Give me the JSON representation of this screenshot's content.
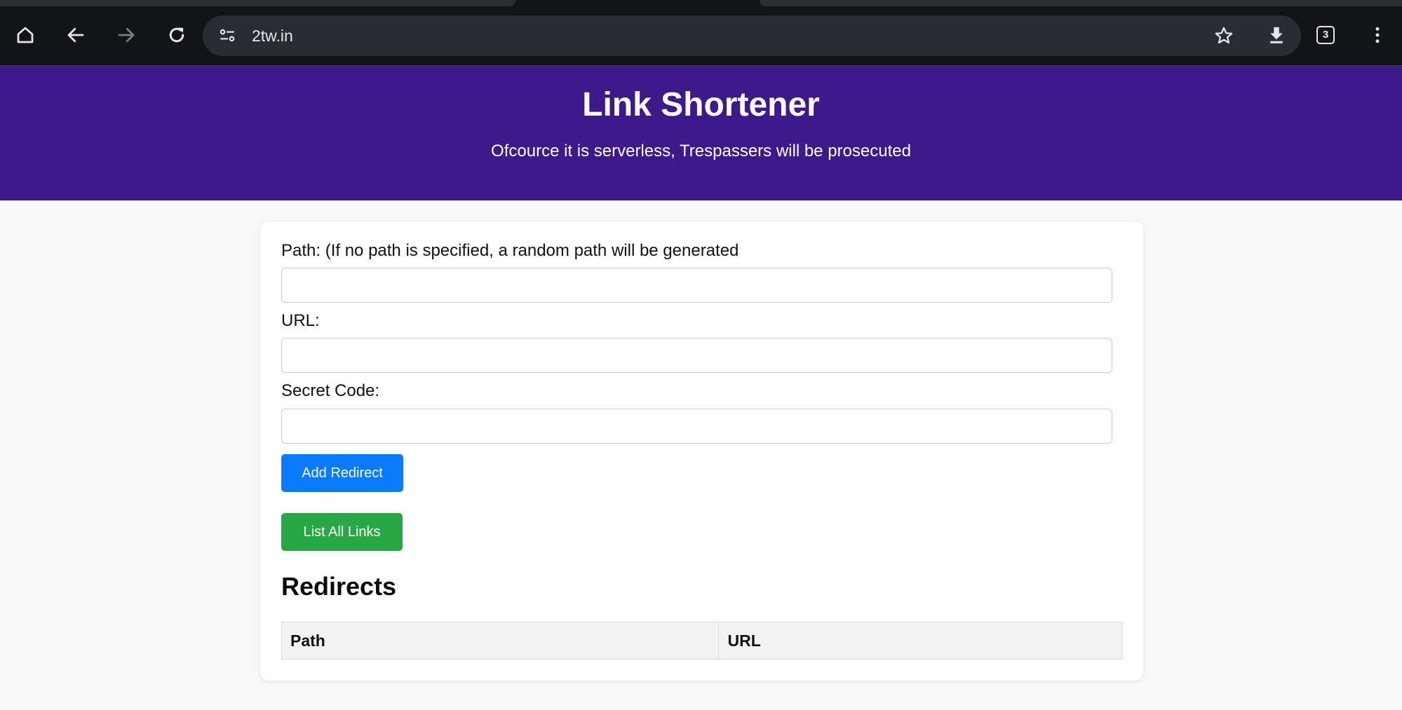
{
  "browser": {
    "url": "2tw.in",
    "tab_count": "3",
    "icons": {
      "home": "home-icon",
      "back": "back-arrow-icon",
      "forward": "forward-arrow-icon",
      "reload": "reload-icon",
      "site_info": "site-settings-icon",
      "bookmark": "star-icon",
      "download": "download-icon",
      "menu": "kebab-menu-icon"
    }
  },
  "header": {
    "title": "Link Shortener",
    "subtitle": "Ofcource it is serverless, Trespassers will be prosecuted",
    "background_color": "#3d198a"
  },
  "form": {
    "path_label": "Path: (If no path is specified, a random path will be generated",
    "path_value": "",
    "url_label": "URL:",
    "url_value": "",
    "secret_label": "Secret Code:",
    "secret_value": "",
    "add_button": "Add Redirect",
    "list_button": "List All Links"
  },
  "redirects": {
    "heading": "Redirects",
    "columns": [
      "Path",
      "URL"
    ],
    "rows": []
  },
  "colors": {
    "add_button": "#0a7bff",
    "list_button": "#28a745"
  }
}
